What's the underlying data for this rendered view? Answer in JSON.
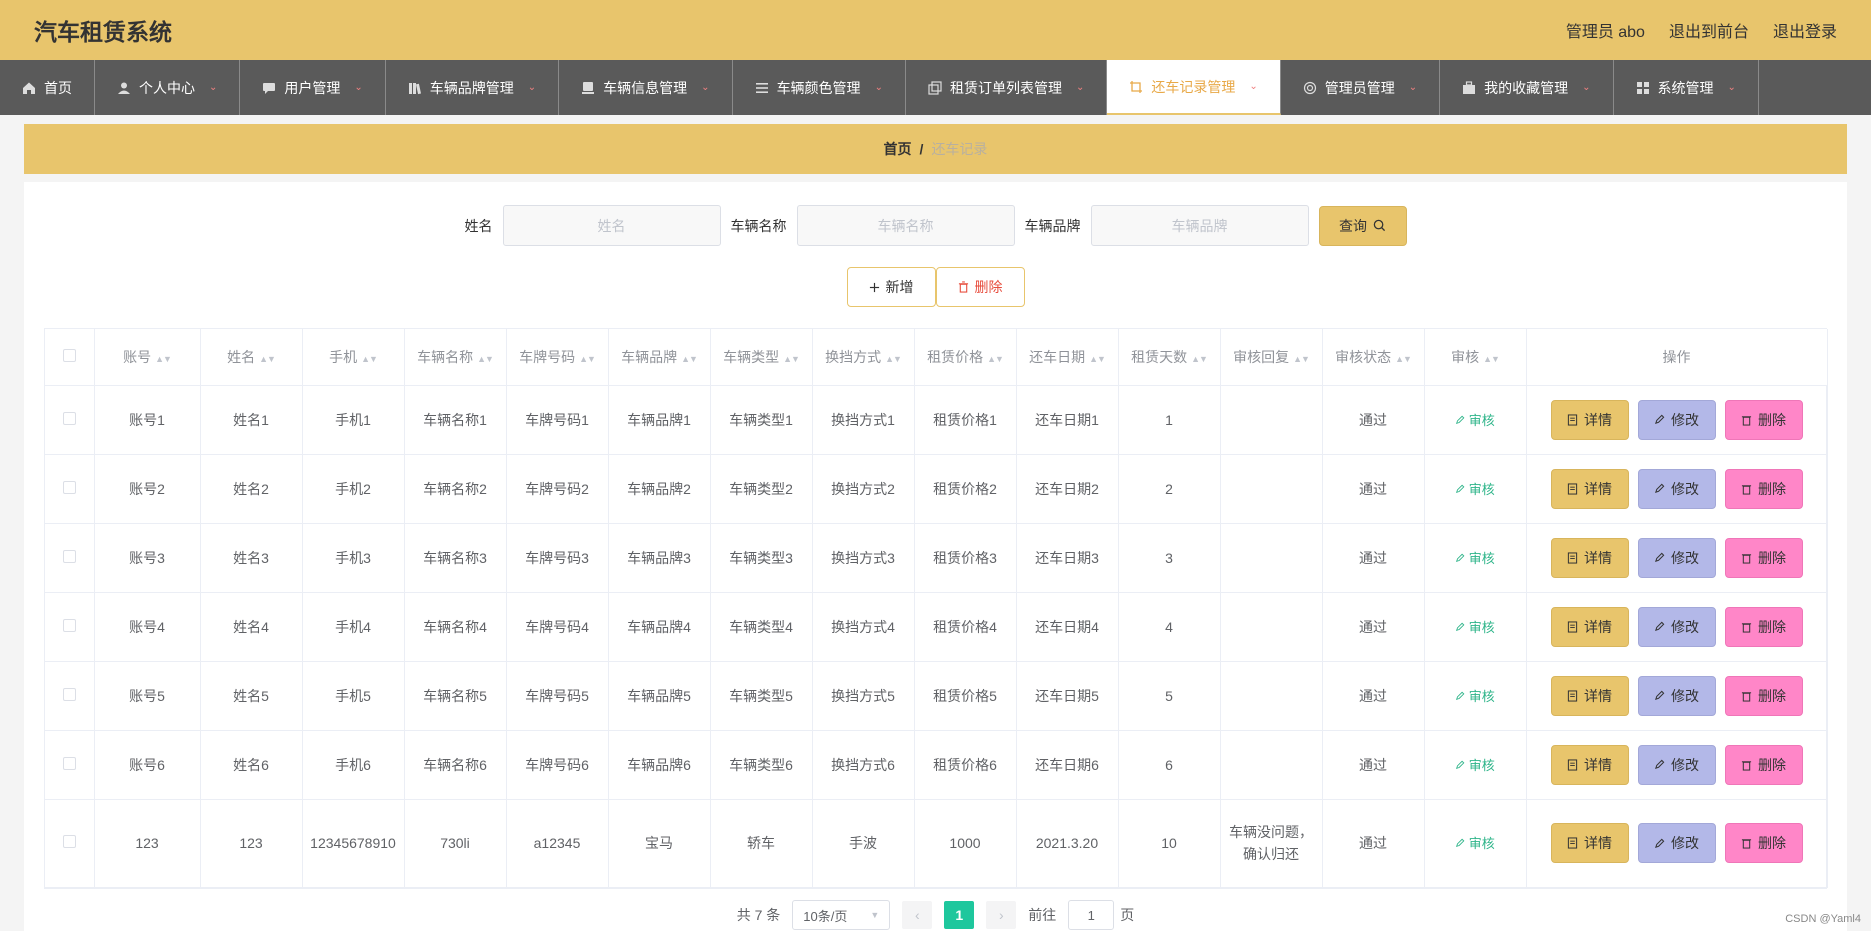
{
  "header": {
    "title": "汽车租赁系统",
    "admin_label": "管理员 abo",
    "to_frontend": "退出到前台",
    "logout": "退出登录"
  },
  "nav": {
    "items": [
      {
        "label": "首页",
        "icon": "home-icon",
        "chevron": false
      },
      {
        "label": "个人中心",
        "icon": "user-icon",
        "chevron": true
      },
      {
        "label": "用户管理",
        "icon": "chat-icon",
        "chevron": true
      },
      {
        "label": "车辆品牌管理",
        "icon": "books-icon",
        "chevron": true
      },
      {
        "label": "车辆信息管理",
        "icon": "card-icon",
        "chevron": true
      },
      {
        "label": "车辆颜色管理",
        "icon": "list-icon",
        "chevron": true
      },
      {
        "label": "租赁订单列表管理",
        "icon": "copy-icon",
        "chevron": true
      },
      {
        "label": "还车记录管理",
        "icon": "crop-icon",
        "chevron": true,
        "active": true
      },
      {
        "label": "管理员管理",
        "icon": "support-icon",
        "chevron": true
      },
      {
        "label": "我的收藏管理",
        "icon": "bag-icon",
        "chevron": true
      },
      {
        "label": "系统管理",
        "icon": "grid-icon",
        "chevron": true
      }
    ]
  },
  "breadcrumb": {
    "home": "首页",
    "separator": "/",
    "current": "还车记录"
  },
  "search": {
    "name_label": "姓名",
    "name_placeholder": "姓名",
    "car_name_label": "车辆名称",
    "car_name_placeholder": "车辆名称",
    "brand_label": "车辆品牌",
    "brand_placeholder": "车辆品牌",
    "query_button": "查询"
  },
  "actions": {
    "add": "新增",
    "delete": "删除"
  },
  "table": {
    "columns": [
      "账号",
      "姓名",
      "手机",
      "车辆名称",
      "车牌号码",
      "车辆品牌",
      "车辆类型",
      "换挡方式",
      "租赁价格",
      "还车日期",
      "租赁天数",
      "审核回复",
      "审核状态",
      "审核",
      "操作"
    ],
    "audit_label": "审核",
    "btn_detail": "详情",
    "btn_edit": "修改",
    "btn_delete": "删除",
    "rows": [
      [
        "账号1",
        "姓名1",
        "手机1",
        "车辆名称1",
        "车牌号码1",
        "车辆品牌1",
        "车辆类型1",
        "换挡方式1",
        "租赁价格1",
        "还车日期1",
        "1",
        "",
        "通过"
      ],
      [
        "账号2",
        "姓名2",
        "手机2",
        "车辆名称2",
        "车牌号码2",
        "车辆品牌2",
        "车辆类型2",
        "换挡方式2",
        "租赁价格2",
        "还车日期2",
        "2",
        "",
        "通过"
      ],
      [
        "账号3",
        "姓名3",
        "手机3",
        "车辆名称3",
        "车牌号码3",
        "车辆品牌3",
        "车辆类型3",
        "换挡方式3",
        "租赁价格3",
        "还车日期3",
        "3",
        "",
        "通过"
      ],
      [
        "账号4",
        "姓名4",
        "手机4",
        "车辆名称4",
        "车牌号码4",
        "车辆品牌4",
        "车辆类型4",
        "换挡方式4",
        "租赁价格4",
        "还车日期4",
        "4",
        "",
        "通过"
      ],
      [
        "账号5",
        "姓名5",
        "手机5",
        "车辆名称5",
        "车牌号码5",
        "车辆品牌5",
        "车辆类型5",
        "换挡方式5",
        "租赁价格5",
        "还车日期5",
        "5",
        "",
        "通过"
      ],
      [
        "账号6",
        "姓名6",
        "手机6",
        "车辆名称6",
        "车牌号码6",
        "车辆品牌6",
        "车辆类型6",
        "换挡方式6",
        "租赁价格6",
        "还车日期6",
        "6",
        "",
        "通过"
      ],
      [
        "123",
        "123",
        "12345678910",
        "730li",
        "a12345",
        "宝马",
        "轿车",
        "手波",
        "1000",
        "2021.3.20",
        "10",
        "车辆没问题，确认归还",
        "通过"
      ]
    ]
  },
  "pagination": {
    "total": "共 7 条",
    "page_size": "10条/页",
    "current_page": "1",
    "goto_label": "前往",
    "goto_value": "1",
    "page_suffix": "页"
  },
  "watermark": "CSDN @Yaml4",
  "colors": {
    "primary": "#e8c56c",
    "nav_bg": "#5a5a5a",
    "active_text": "#e8a948",
    "audit_green": "#2fb58a",
    "edit_bg": "#b3b8e8",
    "delete_bg": "#ff86c8",
    "page_active": "#1ec79d"
  }
}
